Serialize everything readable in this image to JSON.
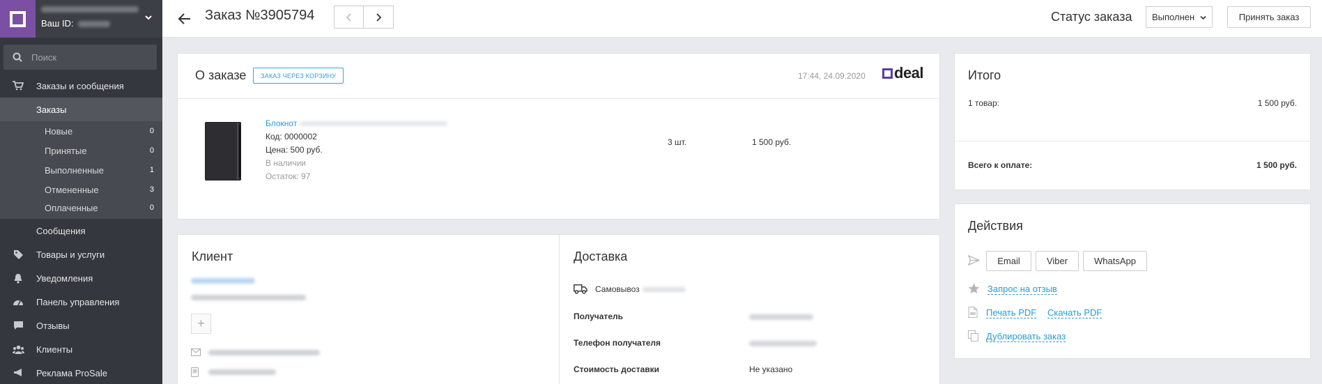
{
  "sidebar": {
    "account_id_label": "Ваш ID:",
    "search_placeholder": "Поиск",
    "nav": {
      "orders_messages": "Заказы и сообщения",
      "orders": "Заказы",
      "orders_sub": [
        {
          "label": "Новые",
          "count": "0"
        },
        {
          "label": "Принятые",
          "count": "0"
        },
        {
          "label": "Выполненные",
          "count": "1"
        },
        {
          "label": "Отмененные",
          "count": "3"
        },
        {
          "label": "Оплаченные",
          "count": "0"
        }
      ],
      "messages": "Сообщения",
      "goods": "Товары и услуги",
      "notifications": "Уведомления",
      "dashboard": "Панель управления",
      "reviews": "Отзывы",
      "clients": "Клиенты",
      "ads": "Реклама ProSale"
    }
  },
  "header": {
    "title": "Заказ №3905794",
    "status_label": "Статус заказа",
    "status_value": "Выполнен",
    "accept_button": "Принять заказ"
  },
  "order": {
    "title": "О заказе",
    "badge": "ЗАКАЗ ЧЕРЕЗ КОРЗИНУ",
    "datetime": "17:44, 24.09.2020",
    "logo_text": "deal",
    "product": {
      "name": "Блокнот",
      "code": "Код: 0000002",
      "price": "Цена: 500 руб.",
      "availability": "В наличии",
      "stock": "Остаток: 97",
      "qty": "3 шт.",
      "sum": "1 500 руб."
    }
  },
  "client": {
    "title": "Клиент"
  },
  "delivery": {
    "title": "Доставка",
    "method": "Самовывоз",
    "rows": [
      {
        "label": "Получатель",
        "value": ""
      },
      {
        "label": "Телефон получателя",
        "value": ""
      },
      {
        "label": "Стоимость доставки",
        "value": "Не указано"
      }
    ]
  },
  "totals": {
    "title": "Итого",
    "items_label": "1 товар:",
    "items_value": "1 500 руб.",
    "total_label": "Всего к оплате:",
    "total_value": "1 500 руб."
  },
  "actions": {
    "title": "Действия",
    "send_buttons": [
      "Email",
      "Viber",
      "WhatsApp"
    ],
    "review_request": "Запрос на отзыв",
    "print_pdf": "Печать PDF",
    "download_pdf": "Скачать PDF",
    "duplicate": "Дублировать заказ"
  },
  "colors": {
    "sidebar_bg": "#34373d",
    "brand_purple": "#7b4fa3",
    "link_blue": "#2b9ad4"
  }
}
